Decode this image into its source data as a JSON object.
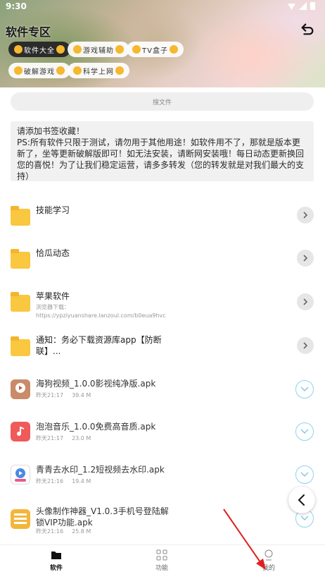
{
  "status_bar": {
    "time": "9:30"
  },
  "header": {
    "title": "软件专区",
    "chips": [
      {
        "label": "软件大全",
        "active": true
      },
      {
        "label": "游戏辅助",
        "active": false
      },
      {
        "label": "TV盒子",
        "active": false
      },
      {
        "label": "破解游戏",
        "active": false
      },
      {
        "label": "科学上网",
        "active": false
      }
    ]
  },
  "search": {
    "placeholder": "搜文件"
  },
  "notice": {
    "text": "请添加书签收藏！\nPS:所有软件只限于测试，请勿用于其他用途！如软件用不了，那就是版本更新了，坐等更新破解版即可！如无法安装，请断网安装哦！每日动态更新换回您的喜悦！为了让我们稳定运营，请多多转发（您的转发就是对我们最大的支持）"
  },
  "folders": [
    {
      "title": "技能学习",
      "sub": ""
    },
    {
      "title": "恰瓜动态",
      "sub": ""
    },
    {
      "title": "苹果软件",
      "sub": "浏览器下载：https://ypziyuanshare.lanzoul.com/b0eua9hvc"
    },
    {
      "title": "通知：务必下载资源库app【防断联】...",
      "sub": ""
    }
  ],
  "files": [
    {
      "title": "海狗视频_1.0.0影视纯净版.apk",
      "time": "昨天21:17",
      "size": "39.4 M",
      "icon_color": "#c98b6a"
    },
    {
      "title": "泡泡音乐_1.0.0免费高音质.apk",
      "time": "昨天21:17",
      "size": "23.0 M",
      "icon_color": "#ef5a5a"
    },
    {
      "title": "青青去水印_1.2短视频去水印.apk",
      "time": "昨天21:16",
      "size": "19.4 M",
      "icon_color": "#4a8be0"
    },
    {
      "title": "头像制作神器_V1.0.3手机号登陆解锁VIP功能.apk",
      "time": "昨天21:16",
      "size": "25.8 M",
      "icon_color": "#f4b63a"
    }
  ],
  "bottom_nav": [
    {
      "label": "软件",
      "active": true
    },
    {
      "label": "功能",
      "active": false
    },
    {
      "label": "我的",
      "active": false
    }
  ]
}
